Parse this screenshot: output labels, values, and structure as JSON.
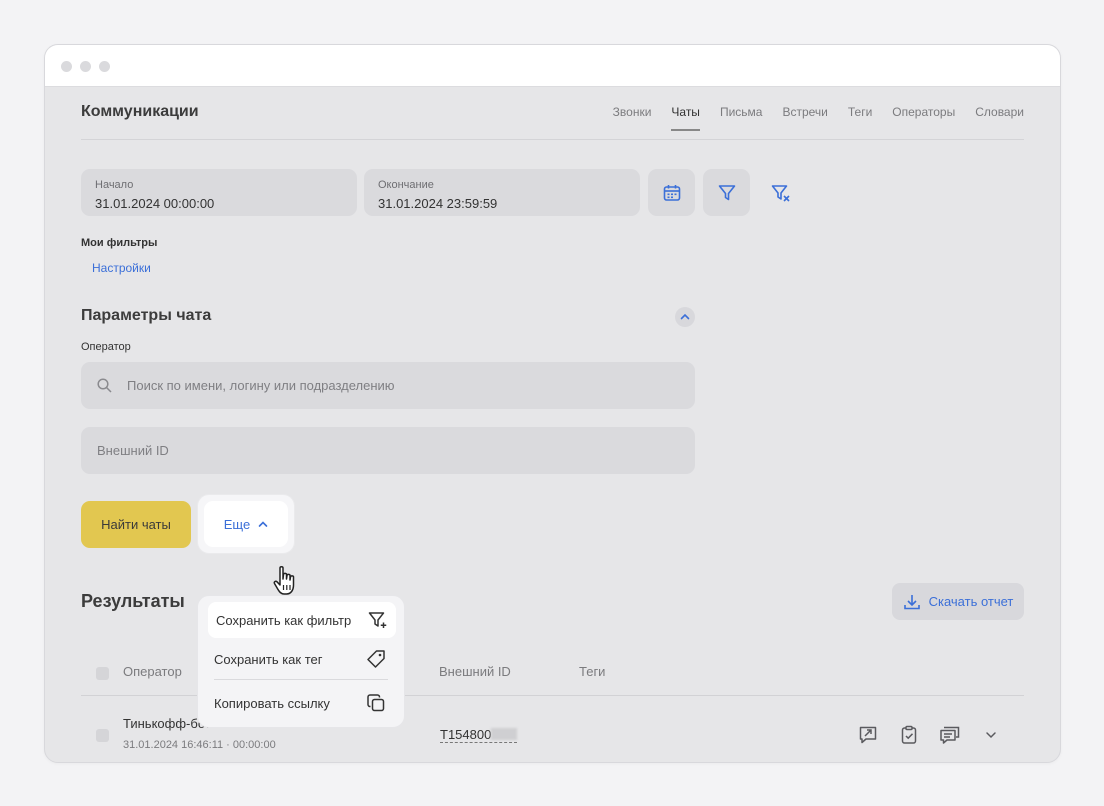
{
  "app": {
    "title": "Коммуникации"
  },
  "nav": {
    "tabs": [
      {
        "label": "Звонки"
      },
      {
        "label": "Чаты",
        "active": true
      },
      {
        "label": "Письма"
      },
      {
        "label": "Встречи"
      },
      {
        "label": "Теги"
      },
      {
        "label": "Операторы"
      },
      {
        "label": "Словари"
      }
    ]
  },
  "dates": {
    "start_label": "Начало",
    "start_value": "31.01.2024 00:00:00",
    "end_label": "Окончание",
    "end_value": "31.01.2024 23:59:59"
  },
  "filters": {
    "title": "Мои фильтры",
    "settings_link": "Настройки"
  },
  "chat_params": {
    "title": "Параметры чата",
    "operator_label": "Оператор",
    "operator_placeholder": "Поиск по имени, логину или подразделению",
    "external_id_placeholder": "Внешний ID"
  },
  "actions": {
    "find_label": "Найти чаты",
    "more_label": "Еще"
  },
  "more_menu": {
    "items": [
      {
        "label": "Сохранить как фильтр",
        "icon": "filter-add-icon"
      },
      {
        "label": "Сохранить как тег",
        "icon": "tag-icon"
      },
      {
        "label": "Копировать ссылку",
        "icon": "copy-icon"
      }
    ]
  },
  "results": {
    "title": "Результаты",
    "download_label": "Скачать отчет",
    "columns": {
      "operator": "Оператор",
      "external_id": "Внешний ID",
      "tags": "Теги"
    },
    "rows": [
      {
        "operator": "Тинькофф-бот",
        "time": "31.01.2024 16:46:11 · 00:00:00",
        "external_id": "T154800"
      }
    ]
  },
  "colors": {
    "accent": "#3b6fd8",
    "primary_button": "#e2c750"
  }
}
